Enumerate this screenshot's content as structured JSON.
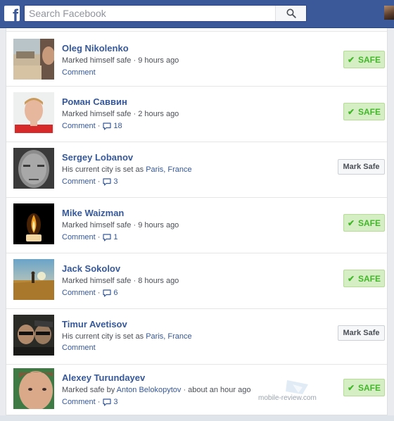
{
  "header": {
    "logo": "f",
    "search_placeholder": "Search Facebook",
    "brand_color": "#3b5998"
  },
  "people": [
    {
      "name": "Oleg Nikolenko",
      "status_prefix": "Marked himself safe · 9 hours ago",
      "status_link": "",
      "status_suffix": "",
      "comment_label": "Comment",
      "comment_count": "",
      "button": "SAFE"
    },
    {
      "name": "Роман Саввин",
      "status_prefix": "Marked himself safe · 2 hours ago",
      "status_link": "",
      "status_suffix": "",
      "comment_label": "Comment",
      "comment_count": "18",
      "button": "SAFE"
    },
    {
      "name": "Sergey Lobanov",
      "status_prefix": "His current city is set as ",
      "status_link": "Paris, France",
      "status_suffix": "",
      "comment_label": "Comment",
      "comment_count": "3",
      "button": "Mark Safe"
    },
    {
      "name": "Mike Waizman",
      "status_prefix": "Marked himself safe · 9 hours ago",
      "status_link": "",
      "status_suffix": "",
      "comment_label": "Comment",
      "comment_count": "1",
      "button": "SAFE"
    },
    {
      "name": "Jack Sokolov",
      "status_prefix": "Marked himself safe · 8 hours ago",
      "status_link": "",
      "status_suffix": "",
      "comment_label": "Comment",
      "comment_count": "6",
      "button": "SAFE"
    },
    {
      "name": "Timur Avetisov",
      "status_prefix": "His current city is set as ",
      "status_link": "Paris, France",
      "status_suffix": "",
      "comment_label": "Comment",
      "comment_count": "",
      "button": "Mark Safe"
    },
    {
      "name": "Alexey Turundayev",
      "status_prefix": "Marked safe by ",
      "status_link": "Anton Belokopytov",
      "status_suffix": " · about an hour ago",
      "comment_label": "Comment",
      "comment_count": "3",
      "button": "SAFE"
    }
  ],
  "watermark": "mobile-review.com",
  "colors": {
    "link": "#365899",
    "safe_green": "#42b72a",
    "safe_bg": "#d6eec4"
  }
}
